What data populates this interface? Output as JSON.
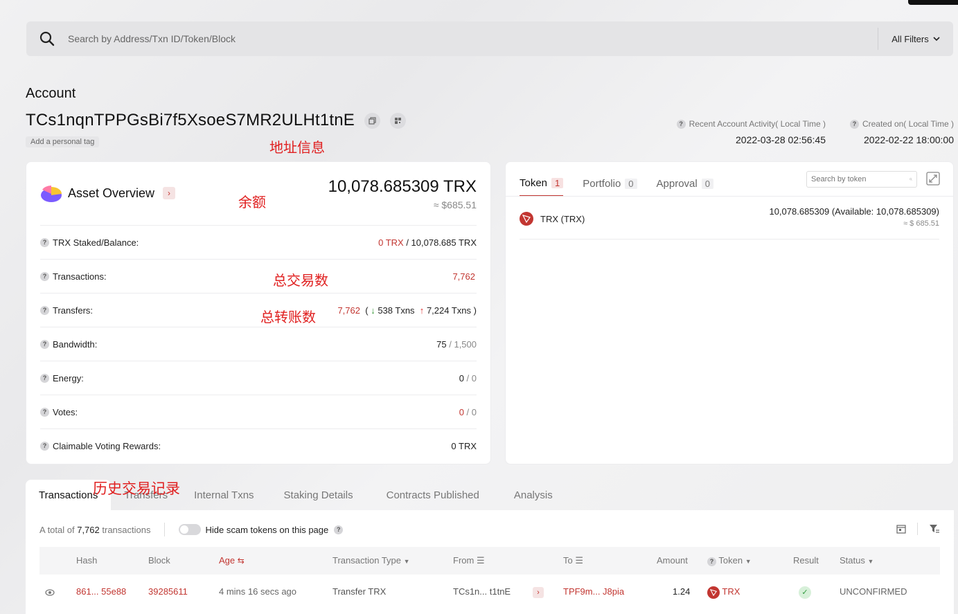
{
  "search": {
    "placeholder": "Search by Address/Txn ID/Token/Block",
    "filters_label": "All Filters"
  },
  "account": {
    "label": "Account",
    "address": "TCs1nqnTPPGsBi7f5XsoeS7MR2ULHt1tnE",
    "tag_label": "Add a personal tag",
    "recent_activity_label": "Recent Account Activity( Local Time )",
    "recent_activity_value": "2022-03-28 02:56:45",
    "created_label": "Created on( Local Time )",
    "created_value": "2022-02-22 18:00:00"
  },
  "annotations": {
    "address_info": "地址信息",
    "balance": "余额",
    "total_txns": "总交易数",
    "total_transfers": "总转账数",
    "history": "历史交易记录"
  },
  "asset": {
    "title": "Asset Overview",
    "balance_trx": "10,078.685309 TRX",
    "balance_usd": "≈ $685.51",
    "rows": {
      "staked_label": "TRX Staked/Balance:",
      "staked_value": "0 TRX",
      "balance_value": " / 10,078.685 TRX",
      "txns_label": "Transactions:",
      "txns_value": "7,762",
      "transfers_label": "Transfers:",
      "transfers_value": "7,762",
      "transfers_in": "538 Txns",
      "transfers_out": "7,224 Txns",
      "bandwidth_label": "Bandwidth:",
      "bandwidth_used": "75",
      "bandwidth_total": " / 1,500",
      "energy_label": "Energy:",
      "energy_used": "0",
      "energy_total": " / 0",
      "votes_label": "Votes:",
      "votes_used": "0",
      "votes_total": " / 0",
      "rewards_label": "Claimable Voting Rewards:",
      "rewards_value": "0 TRX"
    }
  },
  "token_panel": {
    "tabs": [
      {
        "label": "Token",
        "count": "1"
      },
      {
        "label": "Portfolio",
        "count": "0"
      },
      {
        "label": "Approval",
        "count": "0"
      }
    ],
    "search_placeholder": "Search by token",
    "token_name": "TRX (TRX)",
    "token_amount": "10,078.685309 (Available: 10,078.685309)",
    "token_usd": "≈ $ 685.51"
  },
  "history": {
    "tabs": [
      "Transactions",
      "Transfers",
      "Internal Txns",
      "Staking Details",
      "Contracts Published",
      "Analysis"
    ],
    "summary_prefix": "A total of ",
    "summary_count": "7,762",
    "summary_suffix": " transactions",
    "hide_scam_label": "Hide scam tokens on this page",
    "columns": {
      "hash": "Hash",
      "block": "Block",
      "age": "Age",
      "type": "Transaction Type",
      "from": "From",
      "to": "To",
      "amount": "Amount",
      "token": "Token",
      "result": "Result",
      "status": "Status"
    },
    "row": {
      "hash": "861... 55e88",
      "block": "39285611",
      "age": "4 mins 16 secs ago",
      "type": "Transfer TRX",
      "from": "TCs1n... t1tnE",
      "to": "TPF9m... J8pia",
      "amount": "1.24",
      "token": "TRX",
      "status": "UNCONFIRMED"
    }
  },
  "colors": {
    "accent": "#c23631",
    "success": "#2e9a3c"
  }
}
